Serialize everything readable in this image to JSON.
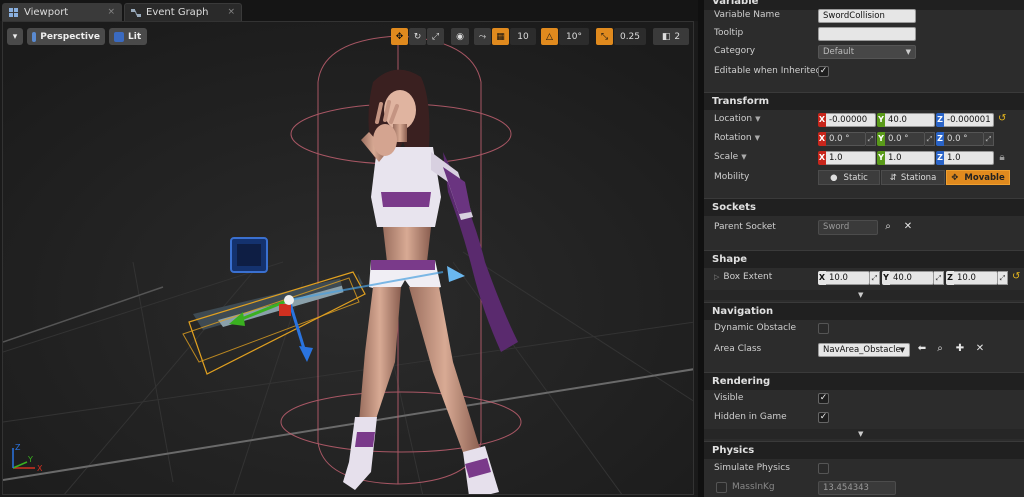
{
  "tabs": [
    {
      "label": "Viewport",
      "close": "×"
    },
    {
      "label": "Event Graph",
      "close": "×"
    }
  ],
  "viewport": {
    "menu_caret": "▾",
    "perspective_label": "Perspective",
    "lit_label": "Lit",
    "grid_snap": "10",
    "rot_snap": "10°",
    "scale_snap": "0.25",
    "cam_speed": "2"
  },
  "details": {
    "variable_header": "Variable",
    "variable_name_label": "Variable Name",
    "variable_name_value": "SwordCollision",
    "tooltip_label": "Tooltip",
    "tooltip_value": "",
    "category_label": "Category",
    "category_value": "Default",
    "editable_label": "Editable when Inherited",
    "transform_header": "Transform",
    "location_label": "Location",
    "location": {
      "x": "-0.00000",
      "y": "40.0",
      "z": "-0.000001"
    },
    "rotation_label": "Rotation",
    "rotation": {
      "x": "0.0 °",
      "y": "0.0 °",
      "z": "0.0 °"
    },
    "scale_label": "Scale",
    "scale": {
      "x": "1.0",
      "y": "1.0",
      "z": "1.0"
    },
    "mobility_label": "Mobility",
    "mobility_options": [
      "Static",
      "Stationa",
      "Movable"
    ],
    "sockets_header": "Sockets",
    "parent_socket_label": "Parent Socket",
    "parent_socket_value": "Sword",
    "shape_header": "Shape",
    "box_extent_label": "Box Extent",
    "box_extent": {
      "x": "10.0",
      "y": "40.0",
      "z": "10.0"
    },
    "navigation_header": "Navigation",
    "dynamic_obstacle_label": "Dynamic Obstacle",
    "area_class_label": "Area Class",
    "area_class_value": "NavArea_Obstacle",
    "rendering_header": "Rendering",
    "visible_label": "Visible",
    "hidden_in_game_label": "Hidden in Game",
    "physics_header": "Physics",
    "simulate_physics_label": "Simulate Physics",
    "mass_label": "MassInKg",
    "mass_value": "13.454343"
  },
  "axis_letters": {
    "x": "X",
    "y": "Y",
    "z": "Z"
  },
  "colors": {
    "accent": "#e08a1e",
    "x_axis": "#c8261c",
    "y_axis": "#5a9a1a",
    "z_axis": "#2a64c8",
    "panel": "#2c2c2c"
  }
}
